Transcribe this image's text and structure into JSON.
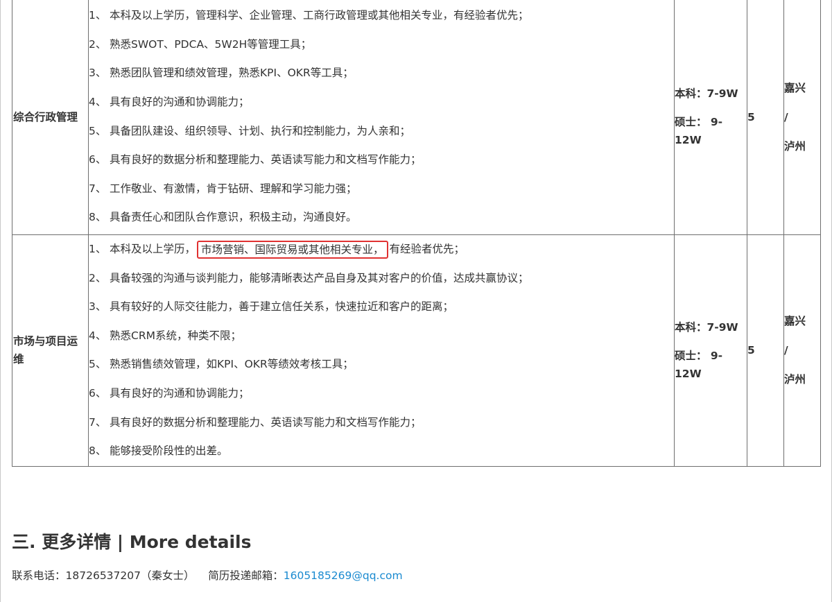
{
  "rows": [
    {
      "position": "综合行政管理",
      "requirements": [
        {
          "num": "1、",
          "text": "本科及以上学历，管理科学、企业管理、工商行政管理或其他相关专业，有经验者优先；"
        },
        {
          "num": "2、",
          "text": "熟悉SWOT、PDCA、5W2H等管理工具；"
        },
        {
          "num": "3、",
          "text": "熟悉团队管理和绩效管理，熟悉KPI、OKR等工具；"
        },
        {
          "num": "4、",
          "text": "具有良好的沟通和协调能力；"
        },
        {
          "num": "5、",
          "text": "具备团队建设、组织领导、计划、执行和控制能力，为人亲和；"
        },
        {
          "num": "6、",
          "text": "具有良好的数据分析和整理能力、英语读写能力和文档写作能力；"
        },
        {
          "num": "7、",
          "text": "工作敬业、有激情，肯于钻研、理解和学习能力强；"
        },
        {
          "num": "8、",
          "text": "具备责任心和团队合作意识，积极主动，沟通良好。"
        }
      ],
      "salary_bachelor": "本科：7-9W",
      "salary_master_1": "硕士： 9-",
      "salary_master_2": "12W",
      "count": "5",
      "city_1": "嘉兴",
      "city_sep": "/",
      "city_2": "泸州"
    },
    {
      "position_line1": "市场与项目运",
      "position_line2": "维",
      "req1": {
        "num": "1、",
        "pre": "本科及以上学历，",
        "highlight": "市场营销、国际贸易或其他相关专业，",
        "post": "有经验者优先；"
      },
      "requirements": [
        {
          "num": "2、",
          "text": "具备较强的沟通与谈判能力，能够清晰表达产品自身及其对客户的价值，达成共赢协议；"
        },
        {
          "num": "3、",
          "text": "具有较好的人际交往能力，善于建立信任关系，快速拉近和客户的距离；"
        },
        {
          "num": "4、",
          "text": "熟悉CRM系统，种类不限；"
        },
        {
          "num": "5、",
          "text": "熟悉销售绩效管理，如KPI、OKR等绩效考核工具；"
        },
        {
          "num": "6、",
          "text": "具有良好的沟通和协调能力；"
        },
        {
          "num": "7、",
          "text": "具有良好的数据分析和整理能力、英语读写能力和文档写作能力；"
        },
        {
          "num": "8、",
          "text": "能够接受阶段性的出差。"
        }
      ],
      "salary_bachelor": "本科：7-9W",
      "salary_master_1": "硕士： 9-",
      "salary_master_2": "12W",
      "count": "5",
      "city_1": "嘉兴",
      "city_sep": "/",
      "city_2": "泸州"
    }
  ],
  "section_title": "三. 更多详情 | More details",
  "contact": {
    "phone_label": "联系电话：",
    "phone": "18726537207（秦女士）",
    "email_label": "简历投递邮箱：",
    "email": "1605185269@qq.com"
  },
  "colors": {
    "highlight_border": "#e03131",
    "link": "#1a8ad0",
    "table_border": "#6e6e6e"
  }
}
